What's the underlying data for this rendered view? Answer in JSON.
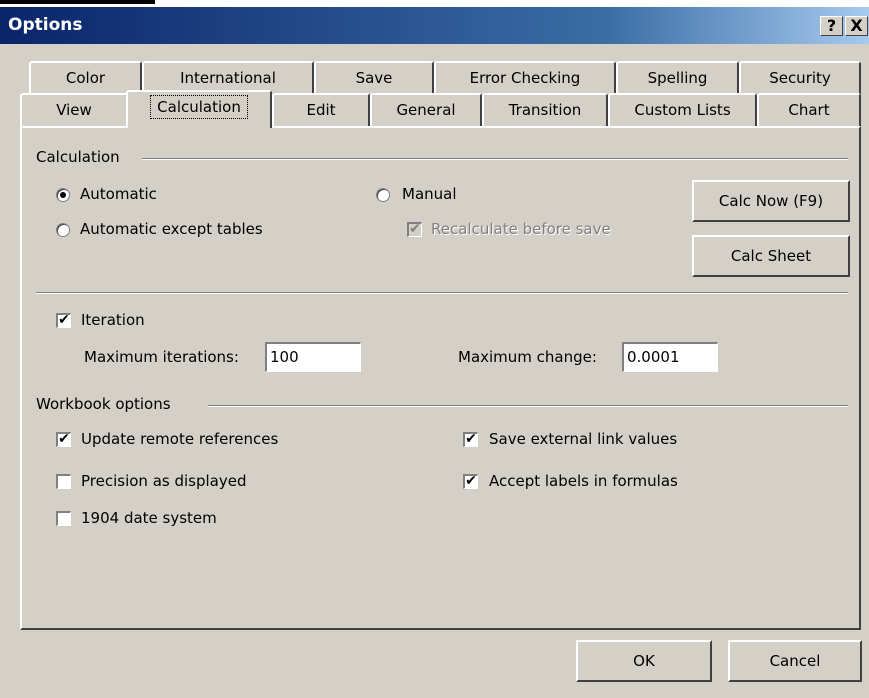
{
  "window": {
    "title": "Options",
    "help_glyph": "?",
    "close_glyph": "X"
  },
  "tabs_row1": [
    "Color",
    "International",
    "Save",
    "Error Checking",
    "Spelling",
    "Security"
  ],
  "tabs_row2": [
    "View",
    "Calculation",
    "Edit",
    "General",
    "Transition",
    "Custom Lists",
    "Chart"
  ],
  "active_tab": "Calculation",
  "calculation": {
    "group_label": "Calculation",
    "automatic": "Automatic",
    "automatic_except_tables": "Automatic except tables",
    "manual": "Manual",
    "recalculate_before_save": "Recalculate before save",
    "selected_mode": "Automatic",
    "calc_now_label": "Calc Now (F9)",
    "calc_sheet_label": "Calc Sheet"
  },
  "iteration": {
    "label": "Iteration",
    "checked": true,
    "max_iterations_label": "Maximum iterations:",
    "max_iterations_value": "100",
    "max_change_label": "Maximum change:",
    "max_change_value": "0.0001"
  },
  "workbook": {
    "group_label": "Workbook options",
    "update_remote": "Update remote references",
    "precision": "Precision as displayed",
    "date_1904": "1904 date system",
    "save_external": "Save external link values",
    "accept_labels": "Accept labels in formulas"
  },
  "footer": {
    "ok_label": "OK",
    "cancel_label": "Cancel"
  },
  "check_glyph": "✔"
}
